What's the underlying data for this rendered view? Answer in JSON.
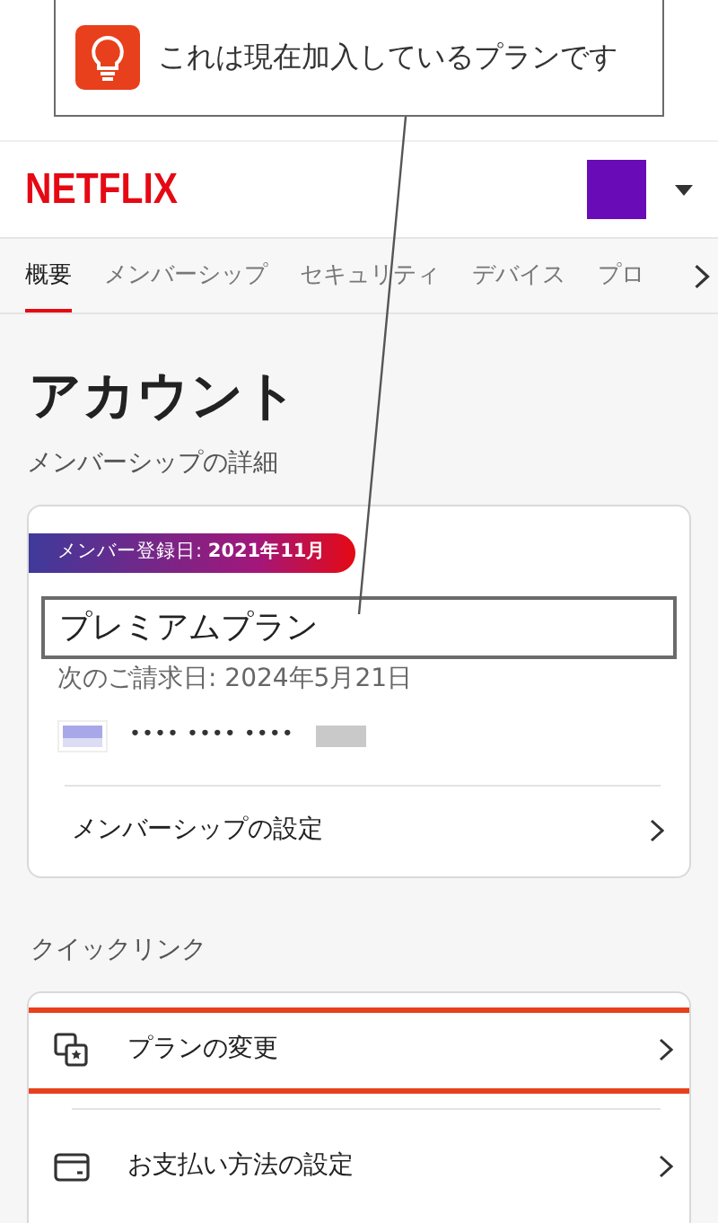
{
  "callout": {
    "text": "これは現在加入しているプランです"
  },
  "header": {
    "logo": "NETFLIX"
  },
  "tabs": [
    {
      "label": "概要",
      "selected": true
    },
    {
      "label": "メンバーシップ",
      "selected": false
    },
    {
      "label": "セキュリティ",
      "selected": false
    },
    {
      "label": "デバイス",
      "selected": false
    },
    {
      "label": "プロ",
      "selected": false
    }
  ],
  "page": {
    "title": "アカウント",
    "section": "メンバーシップの詳細"
  },
  "membership": {
    "badge": "メンバー登録日: **2021年11月**",
    "plan": "プレミアムプラン",
    "plan_highlighted": true,
    "next_billing": "次のご請求日: 2024年5月21日",
    "card_number": "•••• •••• ••••",
    "settings_link": "メンバーシップの設定"
  },
  "quick_links": {
    "title": "クイックリンク",
    "items": [
      {
        "label": "プランの変更",
        "kind": "plan",
        "highlighted": true
      },
      {
        "label": "お支払い方法の設定",
        "kind": "payment",
        "highlighted": false
      }
    ]
  }
}
